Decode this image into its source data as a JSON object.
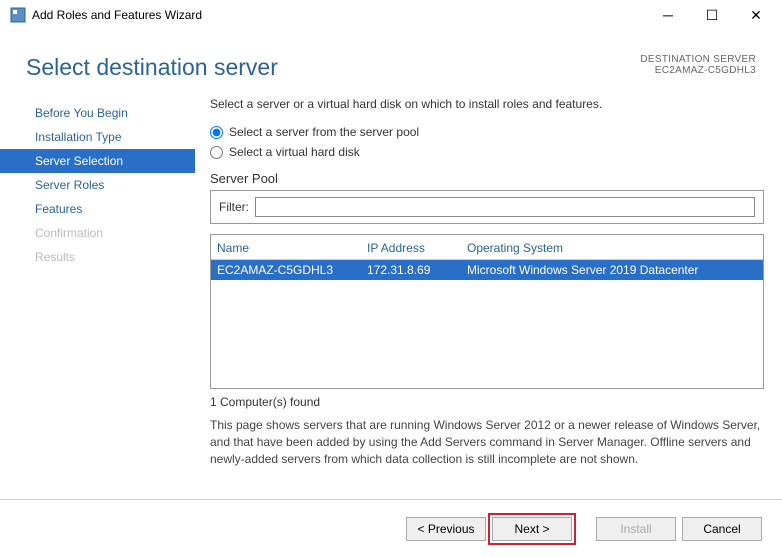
{
  "window": {
    "title": "Add Roles and Features Wizard"
  },
  "header": {
    "page_title": "Select destination server",
    "dest_label": "DESTINATION SERVER",
    "dest_value": "EC2AMAZ-C5GDHL3"
  },
  "nav": {
    "items": [
      {
        "label": "Before You Begin",
        "state": "normal"
      },
      {
        "label": "Installation Type",
        "state": "normal"
      },
      {
        "label": "Server Selection",
        "state": "active"
      },
      {
        "label": "Server Roles",
        "state": "normal"
      },
      {
        "label": "Features",
        "state": "normal"
      },
      {
        "label": "Confirmation",
        "state": "disabled"
      },
      {
        "label": "Results",
        "state": "disabled"
      }
    ]
  },
  "content": {
    "instruction": "Select a server or a virtual hard disk on which to install roles and features.",
    "radio_pool": "Select a server from the server pool",
    "radio_vhd": "Select a virtual hard disk",
    "pool_label": "Server Pool",
    "filter_label": "Filter:",
    "filter_value": "",
    "columns": {
      "name": "Name",
      "ip": "IP Address",
      "os": "Operating System"
    },
    "rows": [
      {
        "name": "EC2AMAZ-C5GDHL3",
        "ip": "172.31.8.69",
        "os": "Microsoft Windows Server 2019 Datacenter"
      }
    ],
    "count_text": "1 Computer(s) found",
    "note": "This page shows servers that are running Windows Server 2012 or a newer release of Windows Server, and that have been added by using the Add Servers command in Server Manager. Offline servers and newly-added servers from which data collection is still incomplete are not shown."
  },
  "footer": {
    "previous": "< Previous",
    "next": "Next >",
    "install": "Install",
    "cancel": "Cancel"
  }
}
